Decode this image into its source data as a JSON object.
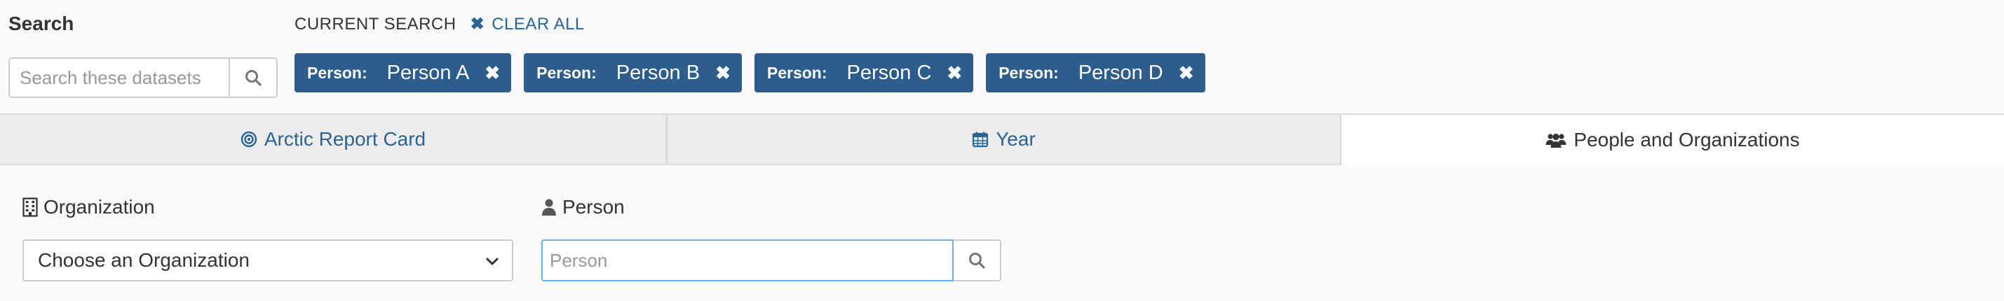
{
  "search": {
    "title": "Search",
    "placeholder": "Search these datasets",
    "search_icon": "search-icon"
  },
  "current_search": {
    "label": "CURRENT SEARCH",
    "clear_all_label": "CLEAR ALL",
    "clear_icon": "close-icon",
    "filters": [
      {
        "key": "Person:",
        "value": "Person A"
      },
      {
        "key": "Person:",
        "value": "Person B"
      },
      {
        "key": "Person:",
        "value": "Person C"
      },
      {
        "key": "Person:",
        "value": "Person D"
      }
    ]
  },
  "tabs": [
    {
      "label": "Arctic Report Card",
      "icon": "bullseye-icon",
      "active": false
    },
    {
      "label": "Year",
      "icon": "calendar-icon",
      "active": false
    },
    {
      "label": "People and Organizations",
      "icon": "users-icon",
      "active": true
    }
  ],
  "panel": {
    "organization_label": "Organization",
    "organization_icon": "building-icon",
    "organization_select_value": "Choose an Organization",
    "person_label": "Person",
    "person_icon": "user-icon",
    "person_placeholder": "Person"
  },
  "colors": {
    "accent": "#2a6496",
    "chip_background": "#2c5d8c",
    "input_focus_border": "#66afe9",
    "tab_inactive_background": "#ececec"
  }
}
